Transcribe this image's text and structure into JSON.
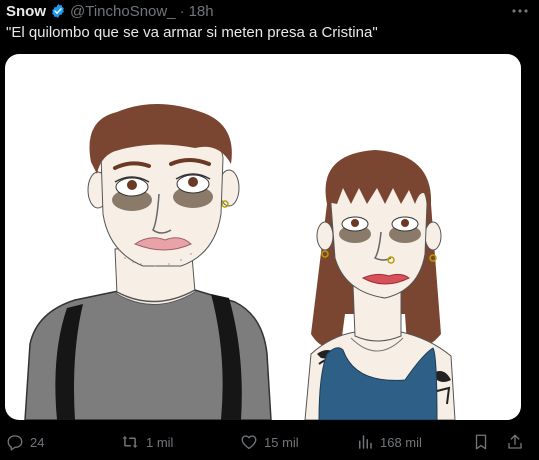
{
  "tweet": {
    "display_name": "Snow",
    "handle": "@TinchoSnow_",
    "separator": "·",
    "time": "18h",
    "text": "\"El quilombo que se va armar si meten presa a Cristina\"",
    "verified_color": "#1d9bf0"
  },
  "actions": {
    "replies": "24",
    "reposts": "1 mil",
    "likes": "15 mil",
    "views": "168 mil",
    "icons": [
      "reply-icon",
      "repost-icon",
      "like-icon",
      "views-icon",
      "bookmark-icon",
      "share-icon"
    ]
  },
  "colors": {
    "background": "#000000",
    "text": "#e7e9ea",
    "muted": "#71767b"
  }
}
